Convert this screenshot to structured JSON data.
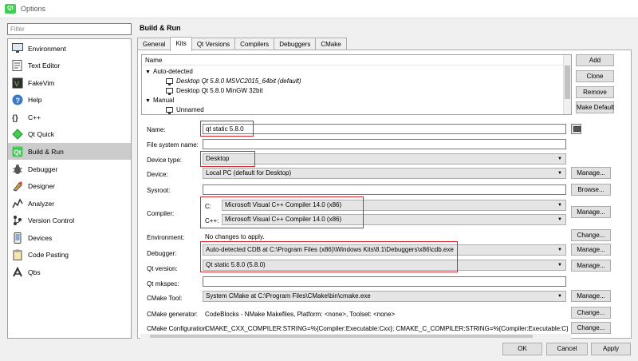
{
  "window": {
    "title": "Options",
    "logo": "Qt"
  },
  "filter": {
    "placeholder": "Filter",
    "value": ""
  },
  "categories": [
    {
      "label": "Environment",
      "icon": "environment-icon"
    },
    {
      "label": "Text Editor",
      "icon": "text-editor-icon"
    },
    {
      "label": "FakeVim",
      "icon": "fakevim-icon"
    },
    {
      "label": "Help",
      "icon": "help-icon"
    },
    {
      "label": "C++",
      "icon": "cpp-icon"
    },
    {
      "label": "Qt Quick",
      "icon": "qt-quick-icon"
    },
    {
      "label": "Build & Run",
      "icon": "build-run-icon",
      "active": true
    },
    {
      "label": "Debugger",
      "icon": "debugger-icon"
    },
    {
      "label": "Designer",
      "icon": "designer-icon"
    },
    {
      "label": "Analyzer",
      "icon": "analyzer-icon"
    },
    {
      "label": "Version Control",
      "icon": "version-control-icon"
    },
    {
      "label": "Devices",
      "icon": "devices-icon"
    },
    {
      "label": "Code Pasting",
      "icon": "code-pasting-icon"
    },
    {
      "label": "Qbs",
      "icon": "qbs-icon"
    }
  ],
  "section_title": "Build & Run",
  "tabs": [
    "General",
    "Kits",
    "Qt Versions",
    "Compilers",
    "Debuggers",
    "CMake"
  ],
  "active_tab": "Kits",
  "kits": {
    "header": "Name",
    "auto_group": "Auto-detected",
    "auto_items": [
      "Desktop Qt 5.8.0 MSVC2015_64bit (default)",
      "Desktop Qt 5.8.0 MinGW 32bit"
    ],
    "manual_group": "Manual",
    "manual_items": [
      "Unnamed"
    ]
  },
  "kit_buttons": {
    "add": "Add",
    "clone": "Clone",
    "remove": "Remove",
    "make_default": "Make Default"
  },
  "form": {
    "name_label": "Name:",
    "name_value": "qt static 5.8.0",
    "fs_label": "File system name:",
    "fs_value": "",
    "device_type_label": "Device type:",
    "device_type_value": "Desktop",
    "device_label": "Device:",
    "device_value": "Local PC (default for Desktop)",
    "sysroot_label": "Sysroot:",
    "sysroot_value": "",
    "compiler_label": "Compiler:",
    "c_label": "C:",
    "c_value": "Microsoft Visual C++ Compiler 14.0 (x86)",
    "cpp_label": "C++:",
    "cpp_value": "Microsoft Visual C++ Compiler 14.0 (x86)",
    "env_label": "Environment:",
    "env_value": "No changes to apply.",
    "debugger_label": "Debugger:",
    "debugger_value": "Auto-detected CDB at C:\\Program Files (x86)\\Windows Kits\\8.1\\Debuggers\\x86\\cdb.exe",
    "qtver_label": "Qt version:",
    "qtver_value": "Qt static 5.8.0 (5.8.0)",
    "mkspec_label": "Qt mkspec:",
    "mkspec_value": "",
    "cmake_tool_label": "CMake Tool:",
    "cmake_tool_value": "System CMake at C:\\Program Files\\CMake\\bin\\cmake.exe",
    "cmake_gen_label": "CMake generator:",
    "cmake_gen_value": "CodeBlocks - NMake Makefiles, Platform: <none>, Toolset: <none>",
    "cmake_conf_label": "CMake Configuration",
    "cmake_conf_value": "CMAKE_CXX_COMPILER:STRING=%{Compiler:Executable:Cxx}; CMAKE_C_COMPILER:STRING=%{Compiler:Executable:C}; CMAKE_P..."
  },
  "side_buttons": {
    "manage": "Manage...",
    "browse": "Browse...",
    "change": "Change..."
  },
  "dialog_buttons": {
    "ok": "OK",
    "cancel": "Cancel",
    "apply": "Apply"
  },
  "colors": {
    "highlight": "#d8262e",
    "active_category": "#cccccc"
  }
}
